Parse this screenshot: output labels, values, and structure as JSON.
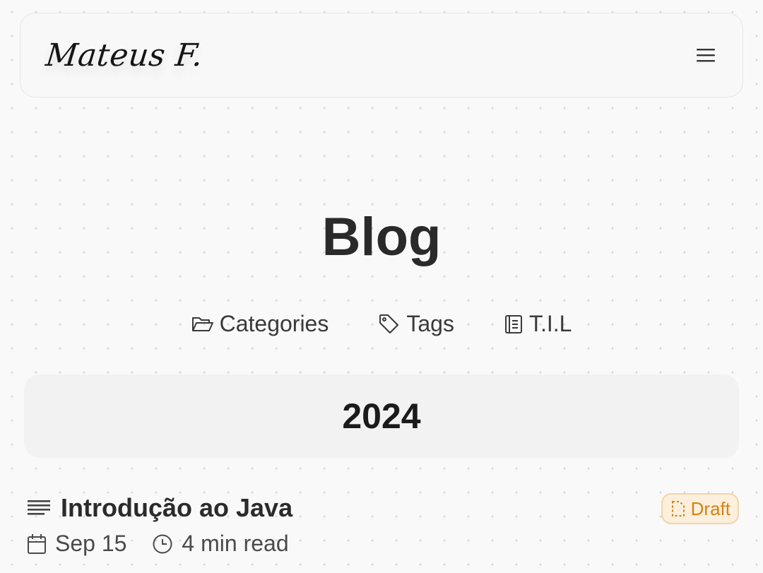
{
  "header": {
    "logo_text": "Mateus F.",
    "menu_icon": "hamburger-menu-icon"
  },
  "page": {
    "title": "Blog"
  },
  "nav": {
    "links": [
      {
        "label": "Categories",
        "icon": "folder-open-icon"
      },
      {
        "label": "Tags",
        "icon": "tag-icon"
      },
      {
        "label": "T.I.L",
        "icon": "notebook-icon"
      }
    ]
  },
  "archive": {
    "year": "2024",
    "posts": [
      {
        "title": "Introdução ao Java",
        "date": "Sep 15",
        "reading_time": "4 min read",
        "badge": "Draft",
        "icons": {
          "title": "text-lines-icon",
          "date": "calendar-icon",
          "time": "clock-icon",
          "badge": "draft-file-icon"
        }
      }
    ]
  },
  "colors": {
    "background": "#f9f9f9",
    "draft_accent": "#d68116",
    "draft_background": "#fcefdc"
  }
}
